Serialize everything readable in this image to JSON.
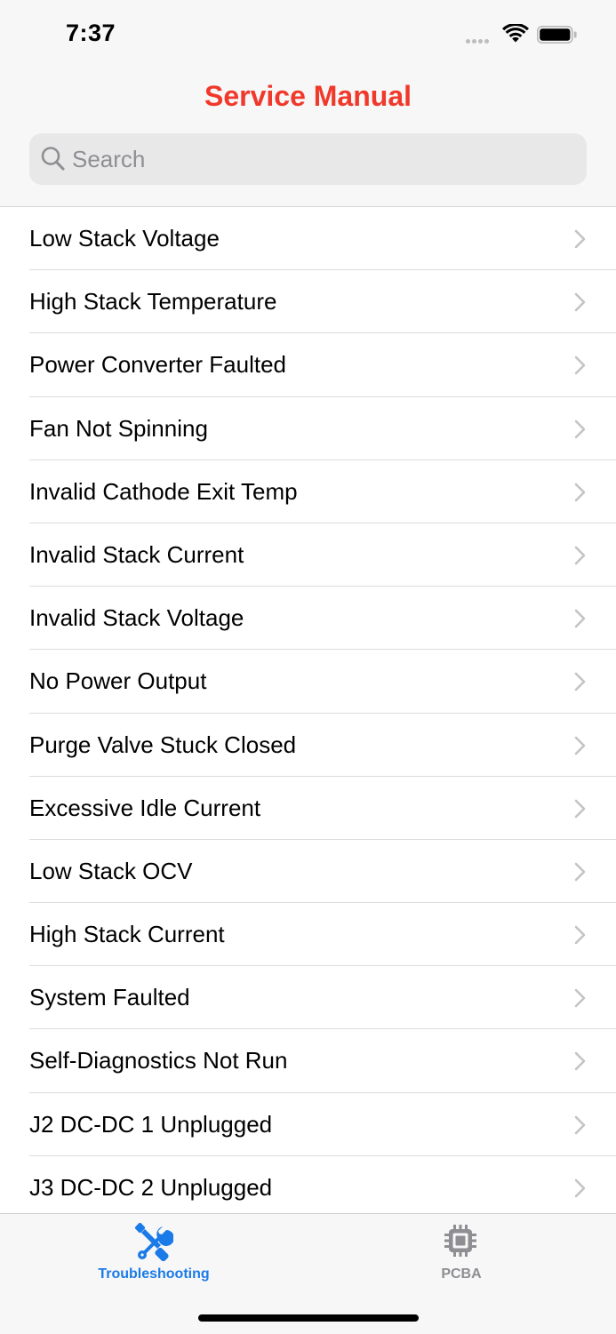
{
  "status_bar": {
    "time": "7:37",
    "wifi_icon": "wifi-icon",
    "battery_icon": "battery-icon",
    "signal_icon": "cellular-signal-icon"
  },
  "nav": {
    "title": "Service Manual",
    "title_color": "#f0392b"
  },
  "search": {
    "placeholder": "Search",
    "value": "",
    "icon": "search-icon"
  },
  "list": {
    "items": [
      {
        "label": "Low Stack Voltage"
      },
      {
        "label": "High Stack Temperature"
      },
      {
        "label": "Power Converter Faulted"
      },
      {
        "label": "Fan Not Spinning"
      },
      {
        "label": "Invalid Cathode Exit Temp"
      },
      {
        "label": "Invalid Stack Current"
      },
      {
        "label": "Invalid Stack Voltage"
      },
      {
        "label": "No Power Output"
      },
      {
        "label": "Purge Valve Stuck Closed"
      },
      {
        "label": "Excessive Idle Current"
      },
      {
        "label": "Low Stack OCV"
      },
      {
        "label": "High Stack Current"
      },
      {
        "label": "System Faulted"
      },
      {
        "label": "Self-Diagnostics Not Run"
      },
      {
        "label": "J2 DC-DC 1 Unplugged"
      },
      {
        "label": "J3 DC-DC 2 Unplugged"
      }
    ],
    "chevron_icon": "chevron-right-icon"
  },
  "tab_bar": {
    "tabs": [
      {
        "label": "Troubleshooting",
        "icon": "tools-icon",
        "selected": true
      },
      {
        "label": "PCBA",
        "icon": "chip-icon",
        "selected": false
      }
    ],
    "active_color": "#1a7ae8",
    "inactive_color": "#8e8e93"
  }
}
